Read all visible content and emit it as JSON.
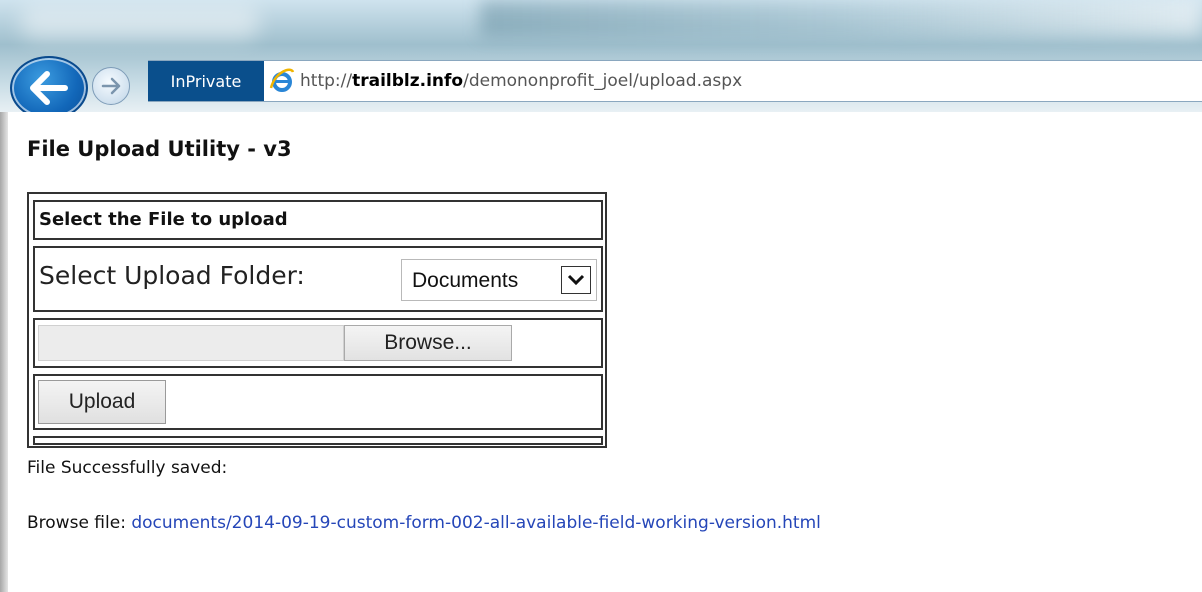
{
  "browser": {
    "inprivate_label": "InPrivate",
    "url_prefix": "http://",
    "url_domain": "trailblz.info",
    "url_path": "/demononprofit_joel/upload.aspx"
  },
  "page": {
    "title": "File Upload Utility - v3"
  },
  "form": {
    "header": "Select the File to upload",
    "folder_label": "Select Upload Folder:",
    "folder_selected": "Documents",
    "browse_label": "Browse...",
    "upload_label": "Upload"
  },
  "result": {
    "status": "File Successfully saved:",
    "browse_prefix": "Browse file:",
    "file_link": "documents/2014-09-19-custom-form-002-all-available-field-working-version.html"
  },
  "colors": {
    "link": "#2546b8",
    "inprivate_bg": "#0a4f8c",
    "back_button": "#1267b9"
  },
  "icons": [
    "back-arrow-icon",
    "forward-arrow-icon",
    "ie-logo-icon",
    "chevron-down-icon"
  ]
}
